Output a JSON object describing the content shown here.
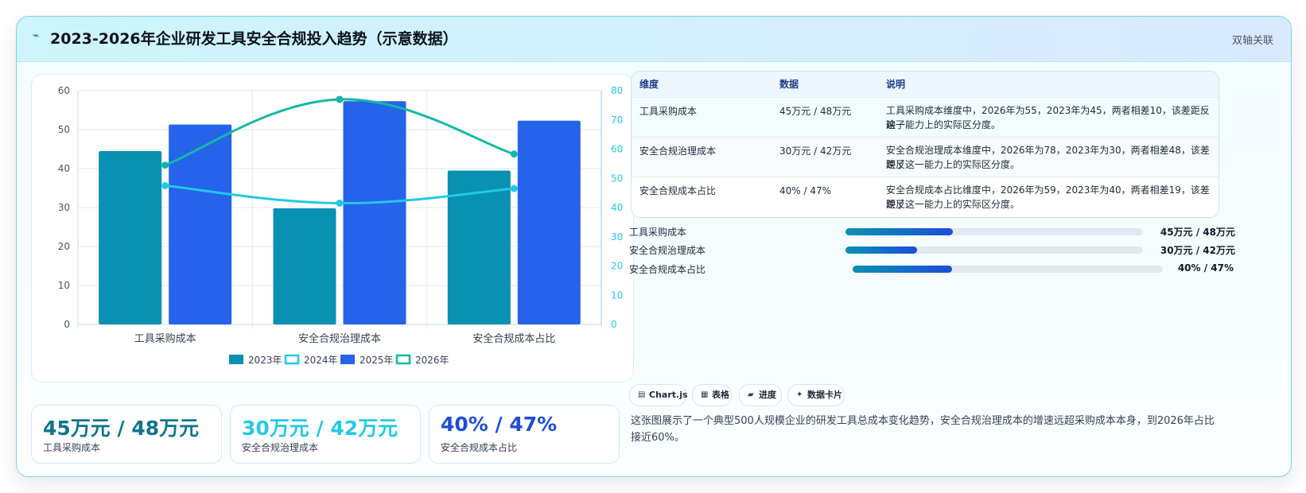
{
  "header": {
    "icon": "bolt-icon",
    "title": "2023-2026年企业研发工具安全合规投入趋势（示意数据）",
    "tag": "双轴关联"
  },
  "chart_data": {
    "type": "bar",
    "categories": [
      "工具采购成本",
      "安全合规治理成本",
      "安全合规成本占比"
    ],
    "y_left": {
      "ticks": [
        0,
        10,
        20,
        30,
        40,
        50,
        60
      ],
      "ylim": [
        0,
        60
      ]
    },
    "y_right": {
      "ticks": [
        0,
        10,
        20,
        30,
        40,
        50,
        60,
        70,
        80
      ],
      "ylim": [
        0,
        80
      ]
    },
    "grid": true,
    "legend_position": "bottom",
    "series": [
      {
        "name": "2023年",
        "type": "bar",
        "axis": "left",
        "color": "#0891b2",
        "values": [
          44.5,
          29.8,
          39.5
        ]
      },
      {
        "name": "2024年",
        "type": "line",
        "axis": "right",
        "color": "#22c9e6",
        "values": [
          47.5,
          41.5,
          46.5
        ]
      },
      {
        "name": "2025年",
        "type": "bar",
        "axis": "left",
        "color": "#2563eb",
        "values": [
          51.3,
          57.3,
          52.3
        ]
      },
      {
        "name": "2026年",
        "type": "line",
        "axis": "right",
        "color": "#14b8a6",
        "values": [
          54.5,
          77.0,
          58.3
        ]
      }
    ]
  },
  "kpis": [
    {
      "value": "45万元 / 48万元",
      "label": "工具采购成本",
      "color": "#0e7490"
    },
    {
      "value": "30万元 / 42万元",
      "label": "安全合规治理成本",
      "color": "#22c9e6"
    },
    {
      "value": "40% / 47%",
      "label": "安全合规成本占比",
      "color": "#1d4ed8"
    }
  ],
  "table": {
    "headers": [
      "维度",
      "数据",
      "说明"
    ],
    "rows": [
      {
        "dim": "工具采购成本",
        "data": "45万元 / 48万元",
        "desc_1": "工具采购成本维度中，2026年为55，2023年为45，两者相差10，该差距反映了",
        "desc_2": "这一能力上的实际区分度。"
      },
      {
        "dim": "安全合规治理成本",
        "data": "30万元 / 42万元",
        "desc_1": "安全合规治理成本维度中，2026年为78，2023年为30，两者相差48，该差距反",
        "desc_2": "映了这一能力上的实际区分度。"
      },
      {
        "dim": "安全合规成本占比",
        "data": "40% / 47%",
        "desc_1": "安全合规成本占比维度中，2026年为59，2023年为40，两者相差19，该差距反",
        "desc_2": "映了这一能力上的实际区分度。"
      }
    ]
  },
  "progress": [
    {
      "label": "工具采购成本",
      "value": "45万元 / 48万元",
      "fill": 0.36
    },
    {
      "label": "安全合规治理成本",
      "value": "30万元 / 42万元",
      "fill": 0.24
    },
    {
      "label": "安全合规成本占比",
      "value": "40% / 47%",
      "fill": 0.32
    }
  ],
  "chips": [
    {
      "icon": "chart-icon",
      "glyph": "▤",
      "label": "Chart.js"
    },
    {
      "icon": "table-icon",
      "glyph": "▦",
      "label": "表格"
    },
    {
      "icon": "progress-icon",
      "glyph": "▰",
      "label": "进度"
    },
    {
      "icon": "card-icon",
      "glyph": "✦",
      "label": "数据卡片"
    }
  ],
  "description": "这张图展示了一个典型500人规模企业的研发工具总成本变化趋势，安全合规治理成本的增速远超采购成本本身，到2026年占比接近60%。"
}
